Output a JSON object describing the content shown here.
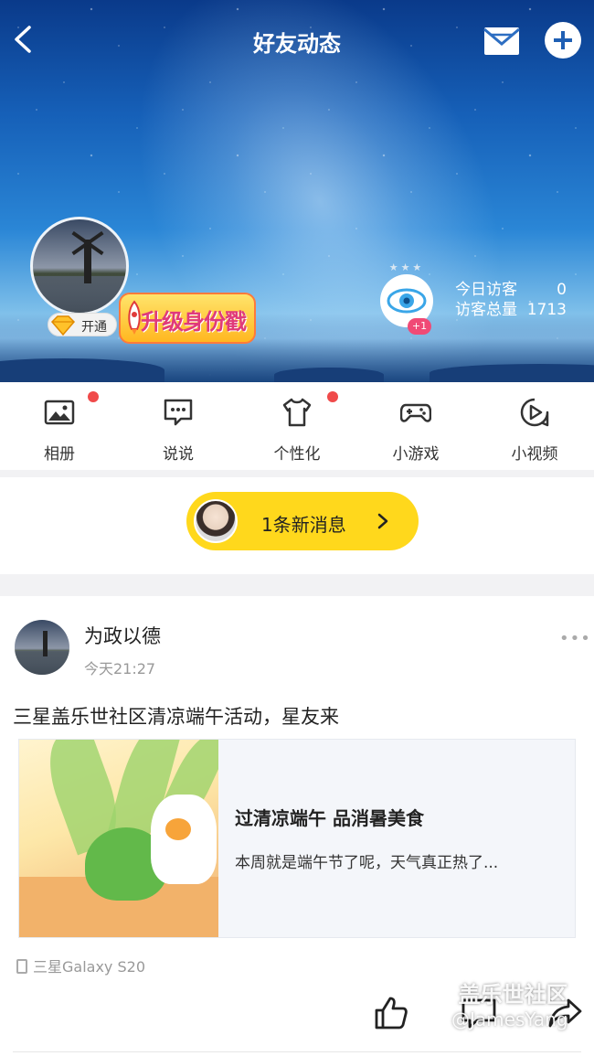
{
  "header": {
    "title": "好友动态",
    "back_icon": "back-arrow-icon",
    "mail_icon": "mail-icon",
    "add_icon": "plus-circle-icon"
  },
  "profile": {
    "vip_label": "开通",
    "upgrade_label": "升级身份戳",
    "visitors": {
      "today_label": "今日访客",
      "today_value": "0",
      "total_label": "访客总量",
      "total_value": "1713",
      "badge": "+1"
    }
  },
  "nav": [
    {
      "label": "相册",
      "icon": "photo-icon",
      "has_dot": true
    },
    {
      "label": "说说",
      "icon": "speech-bubble-icon",
      "has_dot": false
    },
    {
      "label": "个性化",
      "icon": "tshirt-icon",
      "has_dot": true
    },
    {
      "label": "小游戏",
      "icon": "gamepad-icon",
      "has_dot": false
    },
    {
      "label": "小视频",
      "icon": "play-video-icon",
      "has_dot": false
    }
  ],
  "notice": {
    "text": "1条新消息"
  },
  "post": {
    "author": "为政以德",
    "time": "今天21:27",
    "text": "三星盖乐世社区清凉端午活动，星友来",
    "card": {
      "title": "过清凉端午 品消暑美食",
      "desc": "本周就是端午节了呢，天气真正热了..."
    },
    "device": "三星Galaxy S20"
  },
  "watermark": {
    "line1": "盖乐世社区",
    "line2": "@JamesYang"
  },
  "colors": {
    "accent": "#ffd81c",
    "dot": "#f04a4a",
    "brand_blue": "#1f5fb4"
  }
}
